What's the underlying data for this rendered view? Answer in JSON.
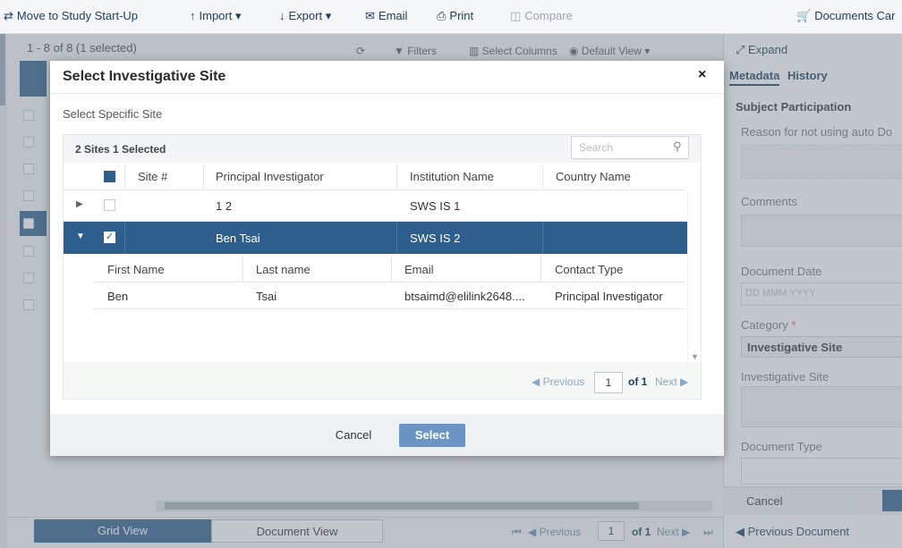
{
  "toolbar": {
    "move": "Move to Study Start-Up",
    "import": "Import",
    "export": "Export",
    "email": "Email",
    "print": "Print",
    "compare": "Compare",
    "documents_cart": "Documents Car"
  },
  "list": {
    "count": "1 - 8 of 8 (1 selected)",
    "filters": "Filters",
    "select_columns": "Select Columns",
    "default_view": "Default View"
  },
  "right_panel": {
    "expand": "Expand",
    "tabs": [
      "Metadata",
      "History"
    ],
    "section": "Subject Participation",
    "reason": "Reason for not using auto Do",
    "comments": "Comments",
    "document_date": "Document Date",
    "date_placeholder": "DD MMM YYYY",
    "category": "Category",
    "category_value": "Investigative Site",
    "investigative_site": "Investigative Site",
    "document_type": "Document Type",
    "cancel": "Cancel",
    "previous_document": "Previous Document"
  },
  "bottom": {
    "grid_view": "Grid View",
    "document_view": "Document View",
    "previous": "Previous",
    "page": "1",
    "of": "of",
    "total": "1",
    "next": "Next"
  },
  "modal": {
    "title": "Select Investigative Site",
    "close": "×",
    "subtitle": "Select Specific Site",
    "sites_count": "2 Sites 1 Selected",
    "search_placeholder": "Search",
    "columns": [
      "Site #",
      "Principal Investigator",
      "Institution Name",
      "Country Name"
    ],
    "rows": [
      {
        "site": "",
        "pi": "1 2",
        "institution": "SWS IS 1",
        "country": "",
        "checked": false,
        "expanded": false
      },
      {
        "site": "",
        "pi": "Ben Tsai",
        "institution": "SWS IS 2",
        "country": "",
        "checked": true,
        "expanded": true
      }
    ],
    "sub_columns": [
      "First Name",
      "Last name",
      "Email",
      "Contact Type"
    ],
    "sub_rows": [
      {
        "first": "Ben",
        "last": "Tsai",
        "email": "btsaimd@elilink2648....",
        "contact_type": "Principal Investigator"
      }
    ],
    "pager": {
      "previous": "Previous",
      "page": "1",
      "of": "of",
      "total": "1",
      "next": "Next"
    },
    "cancel": "Cancel",
    "select": "Select"
  },
  "colors": {
    "primary": "#2e5e8c",
    "accent": "#6a95c4",
    "required": "#e05a5a"
  }
}
